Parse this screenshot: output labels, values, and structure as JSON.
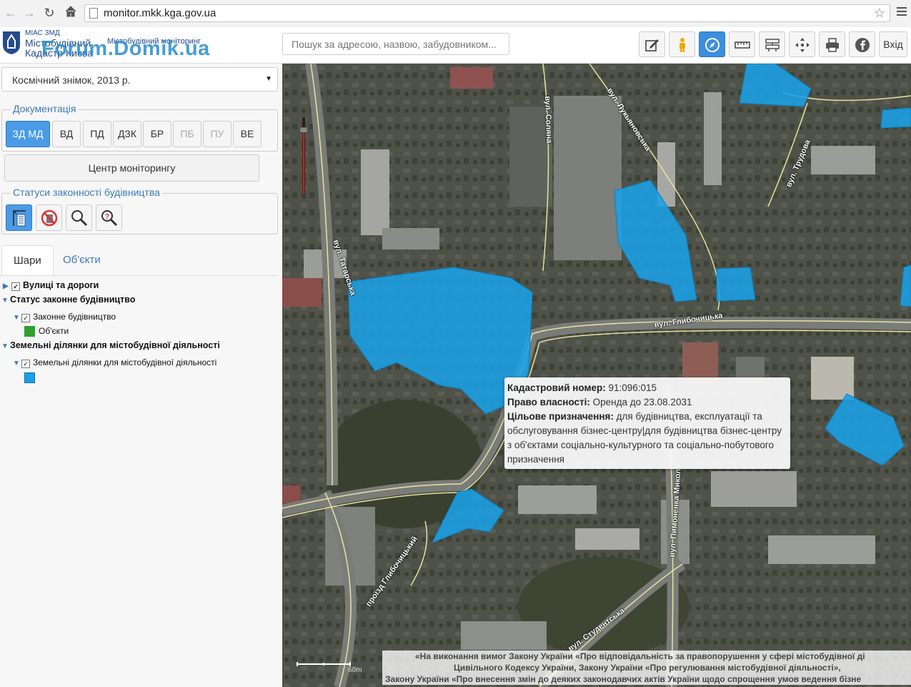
{
  "browser": {
    "url": "monitor.mkk.kga.gov.ua"
  },
  "header": {
    "logo_small": "МІАС ЗМД",
    "logo_line1": "Містобудівний",
    "logo_line2": "Кадастр Києва",
    "logo_sub": "Містобудівний моніторинг",
    "watermark": "Forum.Domik.ua",
    "search_placeholder": "Пошук за адресою, назвою, забудовником...",
    "login_label": "Вхід"
  },
  "sidebar": {
    "basemap_select": "Космічний знімок, 2013 р.",
    "documentation_legend": "Документація",
    "doc_buttons": [
      "ЗД МД",
      "ВД",
      "ПД",
      "ДЗК",
      "БР",
      "ПБ",
      "ПУ",
      "ВЕ"
    ],
    "monitoring_center": "Центр моніторингу",
    "statuses_legend": "Статуси законності будівництва",
    "tabs": [
      "Шари",
      "Об'єкти"
    ],
    "layers": {
      "streets": "Вулиці та дороги",
      "status_group": "Статус законне будівництво",
      "legal_construction": "Законне будівництво",
      "objects": "Об'єкти",
      "land_group": "Земельні ділянки для містобудівної діяльності",
      "land_layer": "Земельні ділянки для містобудівної діяльності"
    }
  },
  "colors": {
    "accent": "#4a9be6",
    "parcel": "#1aa0e6",
    "objects_swatch": "#2ea02e",
    "land_swatch": "#1aa0e6"
  },
  "map": {
    "streets": [
      "вул. Соляна",
      "вул. Лукьяновська",
      "вул. Трудова",
      "вул. Татарська",
      "вул. Глибочицька",
      "вул. Пимоненка Миколи",
      "вул. Студентська",
      "проїзд Глибочицький"
    ],
    "scale_label": "60m",
    "popup": {
      "cadastral_label": "Кадастровий номер:",
      "cadastral_value": "91:096:015",
      "ownership_label": "Право власності:",
      "ownership_value": "Оренда до 23.08.2031",
      "purpose_label": "Цільове призначення:",
      "purpose_value": "для будівництва, експлуатації та обслуговування бізнес-центру|для будівництва бізнес-центру з об'єктами соціально-культурного та соціально-побутового призначення"
    },
    "legal_notice": [
      "«На виконання вимог Закону України «Про відповідальність за правопорушення у сфері містобудівної ді",
      "Цивільного Кодексу України, Закону України «Про регулювання містобудівної діяльності»,",
      "Закону України «Про внесення змін до деяких законодавчих актів України щодо спрощення умов ведення бізне"
    ]
  }
}
